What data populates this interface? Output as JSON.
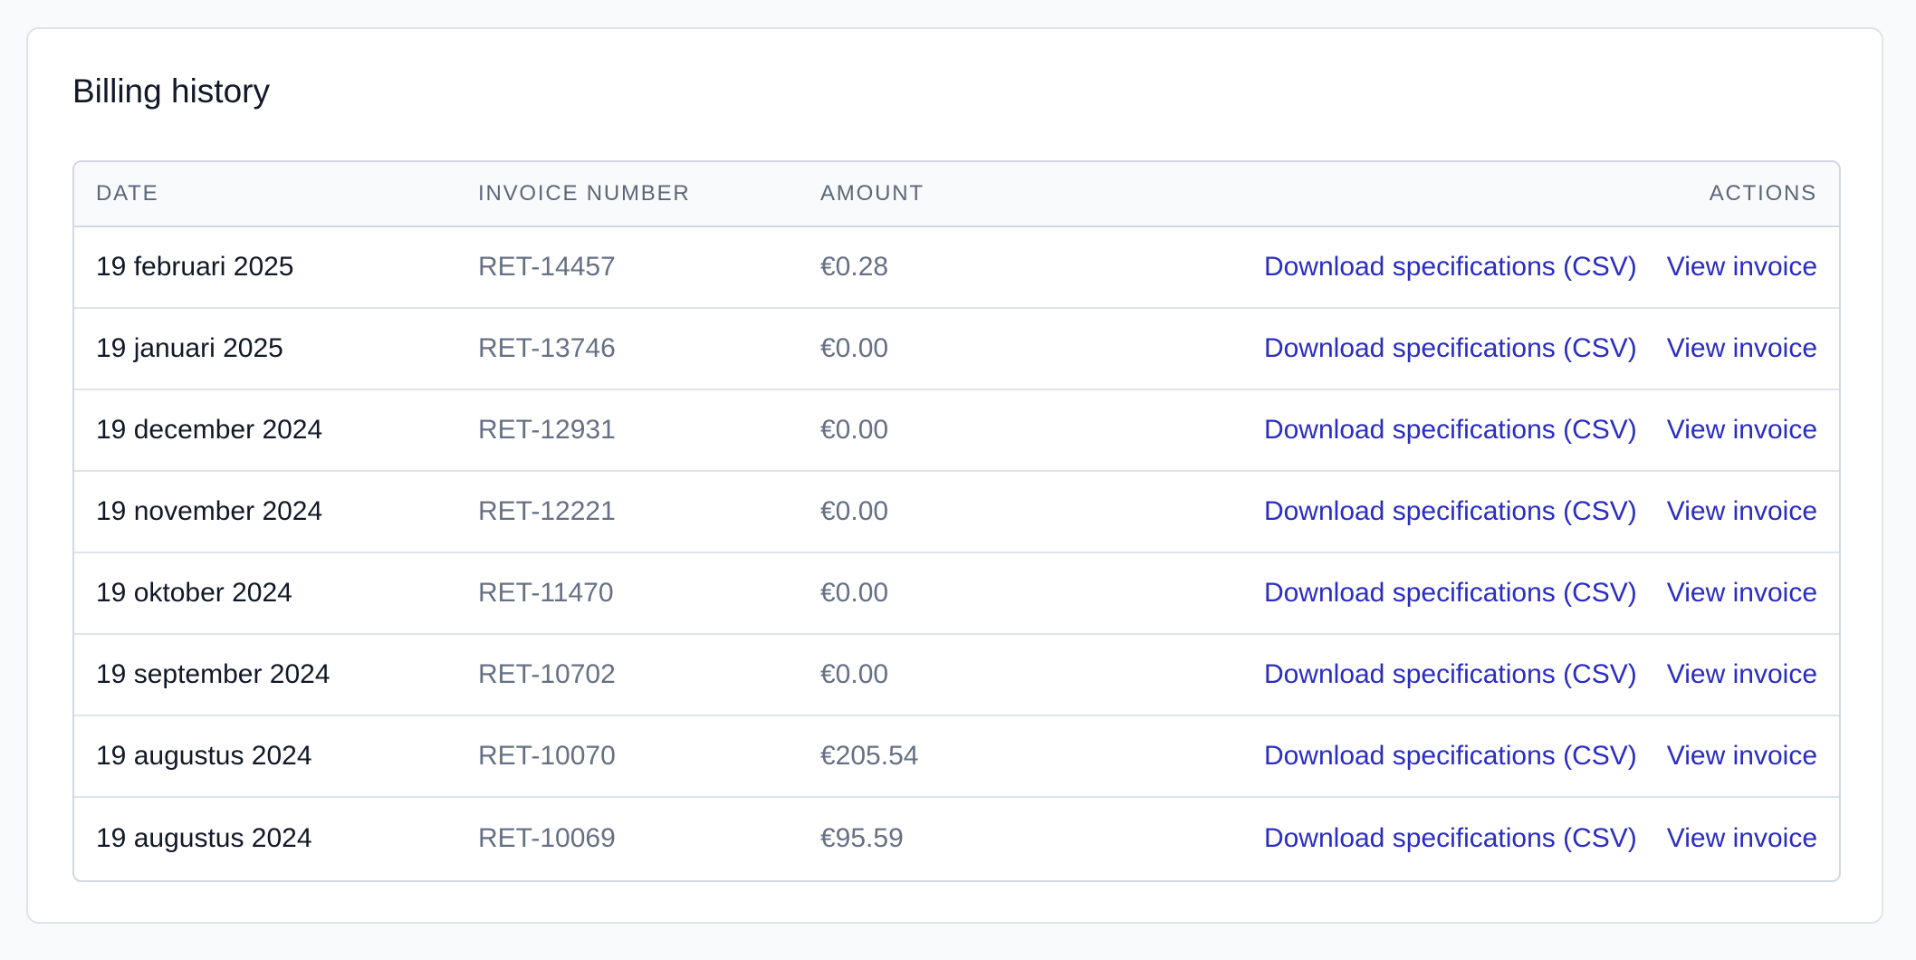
{
  "billing": {
    "title": "Billing history",
    "columns": {
      "date": "DATE",
      "invoice_number": "INVOICE NUMBER",
      "amount": "AMOUNT",
      "actions": "ACTIONS"
    },
    "rows": [
      {
        "date": "19 februari 2025",
        "invoice": "RET-14457",
        "amount": "€0.28",
        "download": "Download specifications (CSV)",
        "view": "View invoice"
      },
      {
        "date": "19 januari 2025",
        "invoice": "RET-13746",
        "amount": "€0.00",
        "download": "Download specifications (CSV)",
        "view": "View invoice"
      },
      {
        "date": "19 december 2024",
        "invoice": "RET-12931",
        "amount": "€0.00",
        "download": "Download specifications (CSV)",
        "view": "View invoice"
      },
      {
        "date": "19 november 2024",
        "invoice": "RET-12221",
        "amount": "€0.00",
        "download": "Download specifications (CSV)",
        "view": "View invoice"
      },
      {
        "date": "19 oktober 2024",
        "invoice": "RET-11470",
        "amount": "€0.00",
        "download": "Download specifications (CSV)",
        "view": "View invoice"
      },
      {
        "date": "19 september 2024",
        "invoice": "RET-10702",
        "amount": "€0.00",
        "download": "Download specifications (CSV)",
        "view": "View invoice"
      },
      {
        "date": "19 augustus 2024",
        "invoice": "RET-10070",
        "amount": "€205.54",
        "download": "Download specifications (CSV)",
        "view": "View invoice"
      },
      {
        "date": "19 augustus 2024",
        "invoice": "RET-10069",
        "amount": "€95.59",
        "download": "Download specifications (CSV)",
        "view": "View invoice"
      }
    ]
  },
  "colors": {
    "link": "#2a2cc4",
    "text_primary": "#111827",
    "text_muted": "#667085",
    "header_bg": "#f8fafc",
    "border": "#d1d8e4"
  }
}
